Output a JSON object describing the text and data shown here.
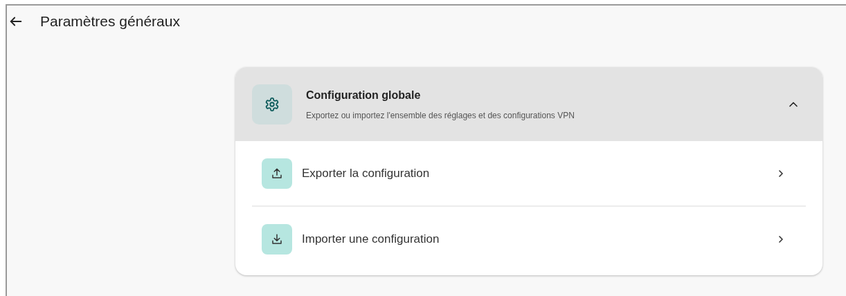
{
  "header": {
    "title": "Paramètres généraux"
  },
  "section": {
    "title": "Configuration globale",
    "subtitle": "Exportez ou importez l'ensemble des réglages et des configurations VPN",
    "expanded": true,
    "items": [
      {
        "kind": "export",
        "label": "Exporter la configuration"
      },
      {
        "kind": "import",
        "label": "Importer une configuration"
      }
    ]
  }
}
